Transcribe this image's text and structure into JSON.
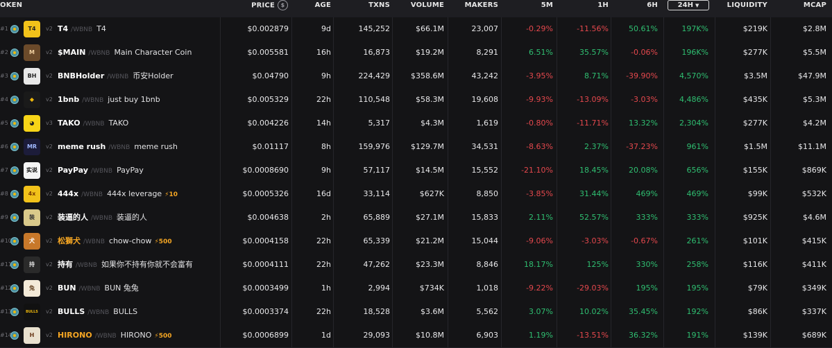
{
  "header": {
    "token": "OKEN",
    "price": "PRICE",
    "price_icon": "dollar-icon",
    "age": "AGE",
    "txns": "TXNS",
    "volume": "VOLUME",
    "makers": "MAKERS",
    "m5": "5M",
    "h1": "1H",
    "h6": "6H",
    "h24": "24H",
    "liquidity": "LIQUIDITY",
    "mcap": "MCAP"
  },
  "colors": {
    "positive": "#2fbf71",
    "negative": "#e5484d",
    "boost": "#f5a623"
  },
  "rows": [
    {
      "rank": "#1",
      "ver": "v2",
      "name": "T4",
      "pair": "/WBNB",
      "full": "T4",
      "boost": "",
      "price": "$0.002879",
      "age": "9d",
      "txns": "145,252",
      "volume": "$66.1M",
      "makers": "23,007",
      "m5": "-0.29%",
      "h1": "-11.56%",
      "h6": "50.61%",
      "h24": "197K%",
      "liq": "$219K",
      "mcap": "$2.8M",
      "logo_bg": "#f2c21a",
      "logo_fg": "#222",
      "logo_text": "T4",
      "orange": false
    },
    {
      "rank": "#2",
      "ver": "v2",
      "name": "$MAIN",
      "pair": "/WBNB",
      "full": "Main Character Coin",
      "boost": "",
      "price": "$0.005581",
      "age": "16h",
      "txns": "16,873",
      "volume": "$19.2M",
      "makers": "8,291",
      "m5": "6.51%",
      "h1": "35.57%",
      "h6": "-0.06%",
      "h24": "196K%",
      "liq": "$277K",
      "mcap": "$5.5M",
      "logo_bg": "#6b4a2a",
      "logo_fg": "#f0d0a0",
      "logo_text": "M",
      "orange": false
    },
    {
      "rank": "#3",
      "ver": "v2",
      "name": "BNBHolder",
      "pair": "/WBNB",
      "full": "币安Holder",
      "boost": "",
      "price": "$0.04790",
      "age": "9h",
      "txns": "224,429",
      "volume": "$358.6M",
      "makers": "43,242",
      "m5": "-3.95%",
      "h1": "8.71%",
      "h6": "-39.90%",
      "h24": "4,570%",
      "liq": "$3.5M",
      "mcap": "$47.9M",
      "logo_bg": "#e8e8e8",
      "logo_fg": "#222",
      "logo_text": "BH",
      "orange": false
    },
    {
      "rank": "#4",
      "ver": "v2",
      "name": "1bnb",
      "pair": "/WBNB",
      "full": "just buy 1bnb",
      "boost": "",
      "price": "$0.005329",
      "age": "22h",
      "txns": "110,548",
      "volume": "$58.3M",
      "makers": "19,608",
      "m5": "-9.93%",
      "h1": "-13.09%",
      "h6": "-3.03%",
      "h24": "4,486%",
      "liq": "$435K",
      "mcap": "$5.3M",
      "logo_bg": "#1a1a1a",
      "logo_fg": "#f0b90b",
      "logo_text": "◆",
      "orange": false
    },
    {
      "rank": "#5",
      "ver": "v3",
      "name": "TAKO",
      "pair": "/WBNB",
      "full": "TAKO",
      "boost": "",
      "price": "$0.004226",
      "age": "14h",
      "txns": "5,317",
      "volume": "$4.3M",
      "makers": "1,619",
      "m5": "-0.80%",
      "h1": "-11.71%",
      "h6": "13.32%",
      "h24": "2,304%",
      "liq": "$277K",
      "mcap": "$4.2M",
      "logo_bg": "#f7d417",
      "logo_fg": "#222",
      "logo_text": "◕",
      "orange": false
    },
    {
      "rank": "#6",
      "ver": "v2",
      "name": "meme rush",
      "pair": "/WBNB",
      "full": "meme rush",
      "boost": "",
      "price": "$0.01117",
      "age": "8h",
      "txns": "159,976",
      "volume": "$129.7M",
      "makers": "34,531",
      "m5": "-8.63%",
      "h1": "2.37%",
      "h6": "-37.23%",
      "h24": "961%",
      "liq": "$1.5M",
      "mcap": "$11.1M",
      "logo_bg": "#1c1c3a",
      "logo_fg": "#9fb7ff",
      "logo_text": "MR",
      "orange": false
    },
    {
      "rank": "#7",
      "ver": "v2",
      "name": "PayPay",
      "pair": "/WBNB",
      "full": "PayPay",
      "boost": "",
      "price": "$0.0008690",
      "age": "9h",
      "txns": "57,117",
      "volume": "$14.5M",
      "makers": "15,552",
      "m5": "-21.10%",
      "h1": "18.45%",
      "h6": "20.08%",
      "h24": "656%",
      "liq": "$155K",
      "mcap": "$869K",
      "logo_bg": "#f4f4f4",
      "logo_fg": "#111",
      "logo_text": "实说",
      "orange": false
    },
    {
      "rank": "#8",
      "ver": "v2",
      "name": "444x",
      "pair": "/WBNB",
      "full": "444x leverage",
      "boost": "⚡10",
      "price": "$0.0005326",
      "age": "16d",
      "txns": "33,114",
      "volume": "$627K",
      "makers": "8,850",
      "m5": "-3.85%",
      "h1": "31.44%",
      "h6": "469%",
      "h24": "469%",
      "liq": "$99K",
      "mcap": "$532K",
      "logo_bg": "#f2c21a",
      "logo_fg": "#7a3a00",
      "logo_text": "4x",
      "orange": false
    },
    {
      "rank": "#9",
      "ver": "v2",
      "name": "装逼的人",
      "pair": "/WBNB",
      "full": "装逼的人",
      "boost": "",
      "price": "$0.004638",
      "age": "2h",
      "txns": "65,889",
      "volume": "$27.1M",
      "makers": "15,833",
      "m5": "2.11%",
      "h1": "52.57%",
      "h6": "333%",
      "h24": "333%",
      "liq": "$925K",
      "mcap": "$4.6M",
      "logo_bg": "#d9c98a",
      "logo_fg": "#333",
      "logo_text": "装",
      "orange": false
    },
    {
      "rank": "#10",
      "ver": "v2",
      "name": "松獅犬",
      "pair": "/WBNB",
      "full": "chow-chow",
      "boost": "⚡500",
      "price": "$0.0004158",
      "age": "22h",
      "txns": "65,339",
      "volume": "$21.2M",
      "makers": "15,044",
      "m5": "-9.06%",
      "h1": "-3.03%",
      "h6": "-0.67%",
      "h24": "261%",
      "liq": "$101K",
      "mcap": "$415K",
      "logo_bg": "#c8782a",
      "logo_fg": "#fff",
      "logo_text": "犬",
      "orange": true
    },
    {
      "rank": "#11",
      "ver": "v2",
      "name": "持有",
      "pair": "/WBNB",
      "full": "如果你不持有你就不会富有",
      "boost": "",
      "price": "$0.0004111",
      "age": "22h",
      "txns": "47,262",
      "volume": "$23.3M",
      "makers": "8,846",
      "m5": "18.17%",
      "h1": "125%",
      "h6": "330%",
      "h24": "258%",
      "liq": "$116K",
      "mcap": "$411K",
      "logo_bg": "#2a2a2a",
      "logo_fg": "#ddd",
      "logo_text": "持",
      "orange": false
    },
    {
      "rank": "#12",
      "ver": "v2",
      "name": "BUN",
      "pair": "/WBNB",
      "full": "BUN 兔兔",
      "boost": "",
      "price": "$0.0003499",
      "age": "1h",
      "txns": "2,994",
      "volume": "$734K",
      "makers": "1,018",
      "m5": "-9.22%",
      "h1": "-29.03%",
      "h6": "195%",
      "h24": "195%",
      "liq": "$79K",
      "mcap": "$349K",
      "logo_bg": "#f3ead8",
      "logo_fg": "#6a4a2a",
      "logo_text": "兔",
      "orange": false
    },
    {
      "rank": "#13",
      "ver": "v2",
      "name": "BULLS",
      "pair": "/WBNB",
      "full": "BULLS",
      "boost": "",
      "price": "$0.0003374",
      "age": "22h",
      "txns": "18,528",
      "volume": "$3.6M",
      "makers": "5,562",
      "m5": "3.07%",
      "h1": "10.02%",
      "h6": "35.45%",
      "h24": "192%",
      "liq": "$86K",
      "mcap": "$337K",
      "logo_bg": "#111",
      "logo_fg": "#f0b90b",
      "logo_text": "BULLS",
      "orange": false
    },
    {
      "rank": "#14",
      "ver": "v2",
      "name": "HIRONO",
      "pair": "/WBNB",
      "full": "HIRONO",
      "boost": "⚡500",
      "price": "$0.0006899",
      "age": "1d",
      "txns": "29,093",
      "volume": "$10.8M",
      "makers": "6,903",
      "m5": "1.19%",
      "h1": "-13.51%",
      "h6": "36.32%",
      "h24": "191%",
      "liq": "$139K",
      "mcap": "$689K",
      "logo_bg": "#e9e1cf",
      "logo_fg": "#6a3a1a",
      "logo_text": "H",
      "orange": true
    }
  ]
}
